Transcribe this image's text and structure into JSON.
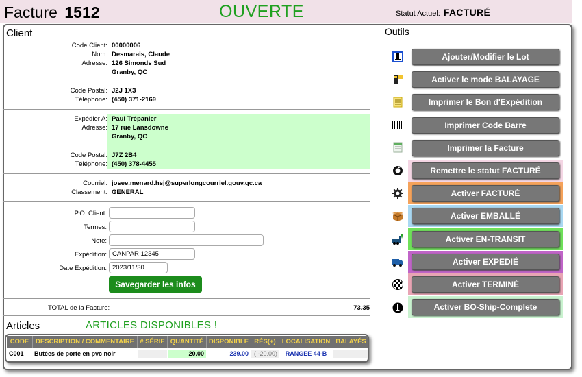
{
  "header": {
    "title": "Facture",
    "number": "1512",
    "status": "OUVERTE",
    "current_label": "Statut Actuel:",
    "current_value": "FACTURÉ"
  },
  "client": {
    "section_title": "Client",
    "code_label": "Code Client:",
    "code": "00000006",
    "name_label": "Nom:",
    "name": "Desmarais, Claude",
    "address_label": "Adresse:",
    "address1": "126 Simonds Sud",
    "address2": "Granby, QC",
    "postal_label": "Code Postal:",
    "postal": "J2J 1X3",
    "phone_label": "Téléphone:",
    "phone": "(450) 371-2169"
  },
  "ship": {
    "to_label": "Expédier A:",
    "to": "Paul Trépanier",
    "address_label": "Adresse:",
    "address1": "17 rue Lansdowne",
    "address2": "Granby, QC",
    "postal_label": "Code Postal:",
    "postal": "J7Z 2B4",
    "phone_label": "Téléphone:",
    "phone": "(450) 378-4455"
  },
  "contact": {
    "email_label": "Courriel:",
    "email": "josee.menard.hsj@superlongcourriel.gouv.qc.ca",
    "class_label": "Classement:",
    "class": "GENERAL"
  },
  "form": {
    "po_label": "P.O. Client:",
    "po_value": "",
    "terms_label": "Termes:",
    "terms_value": "",
    "note_label": "Note:",
    "note_value": "",
    "shipping_label": "Expédition:",
    "shipping_value": "CANPAR 12345",
    "date_label": "Date Expédition:",
    "date_value": "2023/11/30",
    "save_label": "Savegarder les infos"
  },
  "total": {
    "label": "TOTAL de la Facture:",
    "value": "73.35"
  },
  "articles": {
    "title": "Articles",
    "available": "ARTICLES DISPONIBLES !",
    "columns": [
      "CODE",
      "DESCRIPTION / COMMENTAIRE",
      "# SÉRIE",
      "QUANTITÉ",
      "DISPONIBLE",
      "RÉS(+)",
      "LOCALISATION",
      "BALAYÉS"
    ],
    "rows": [
      {
        "code": "C001",
        "description": "Butées de porte en pvc noir",
        "serial": "",
        "quantity": "20.00",
        "available": "239.00",
        "reserved": "( -20.00)",
        "location": "RANGEE 44-B",
        "scanned": ""
      }
    ]
  },
  "tools": {
    "title": "Outils",
    "buttons": [
      {
        "label": "Ajouter/Modifier le Lot",
        "icon": "list-icon",
        "bg": ""
      },
      {
        "label": "Activer le mode BALAYAGE",
        "icon": "scanner-icon",
        "bg": ""
      },
      {
        "label": "Imprimer le Bon d'Expédition",
        "icon": "document-icon",
        "bg": ""
      },
      {
        "label": "Imprimer Code Barre",
        "icon": "barcode-icon",
        "bg": ""
      },
      {
        "label": "Imprimer la Facture",
        "icon": "invoice-icon",
        "bg": ""
      },
      {
        "label": "Remettre le statut FACTURÉ",
        "icon": "reset-icon",
        "bg": "#f4d6e4"
      },
      {
        "label": "Activer FACTURÉ",
        "icon": "gear-icon",
        "bg": "#f5a25a"
      },
      {
        "label": "Activer EMBALLÉ",
        "icon": "box-icon",
        "bg": "#a9d8f2"
      },
      {
        "label": "Activer EN-TRANSIT",
        "icon": "forklift-icon",
        "bg": "#6fe05a"
      },
      {
        "label": "Activer EXPEDIÉ",
        "icon": "truck-icon",
        "bg": "#c064c8"
      },
      {
        "label": "Activer TERMINÉ",
        "icon": "checkered-flag-icon",
        "bg": "#e8a4b4"
      },
      {
        "label": "Activer BO-Ship-Complete",
        "icon": "info-icon",
        "bg": "#c9f2cf"
      }
    ]
  }
}
